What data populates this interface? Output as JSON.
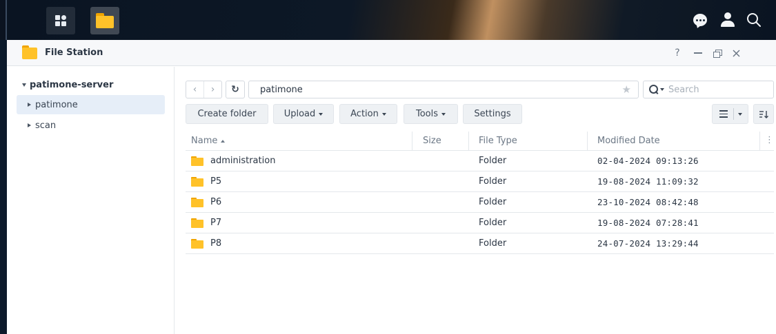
{
  "taskbar": {
    "icons": [
      "main-menu-icon",
      "file-station-icon",
      "notification-chat-icon",
      "user-icon",
      "search-icon"
    ]
  },
  "window": {
    "title": "File Station",
    "controls": {
      "help": "?"
    }
  },
  "sidebar": {
    "root": "patimone-server",
    "items": [
      {
        "label": "patimone",
        "selected": true
      },
      {
        "label": "scan",
        "selected": false
      }
    ]
  },
  "toolbar": {
    "path": "patimone",
    "search_placeholder": "Search",
    "create_folder": "Create folder",
    "upload": "Upload",
    "action": "Action",
    "tools": "Tools",
    "settings": "Settings"
  },
  "table": {
    "columns": {
      "name": "Name",
      "size": "Size",
      "type": "File Type",
      "modified": "Modified Date"
    },
    "rows": [
      {
        "name": "administration",
        "size": "",
        "type": "Folder",
        "modified": "02-04-2024 09:13:26"
      },
      {
        "name": "P5",
        "size": "",
        "type": "Folder",
        "modified": "19-08-2024 11:09:32"
      },
      {
        "name": "P6",
        "size": "",
        "type": "Folder",
        "modified": "23-10-2024 08:42:48"
      },
      {
        "name": "P7",
        "size": "",
        "type": "Folder",
        "modified": "19-08-2024 07:28:41"
      },
      {
        "name": "P8",
        "size": "",
        "type": "Folder",
        "modified": "24-07-2024 13:29:44"
      }
    ]
  },
  "colors": {
    "folder": "#ffc229",
    "selected_bg": "#e6eef8",
    "button_bg": "#eef1f4"
  }
}
